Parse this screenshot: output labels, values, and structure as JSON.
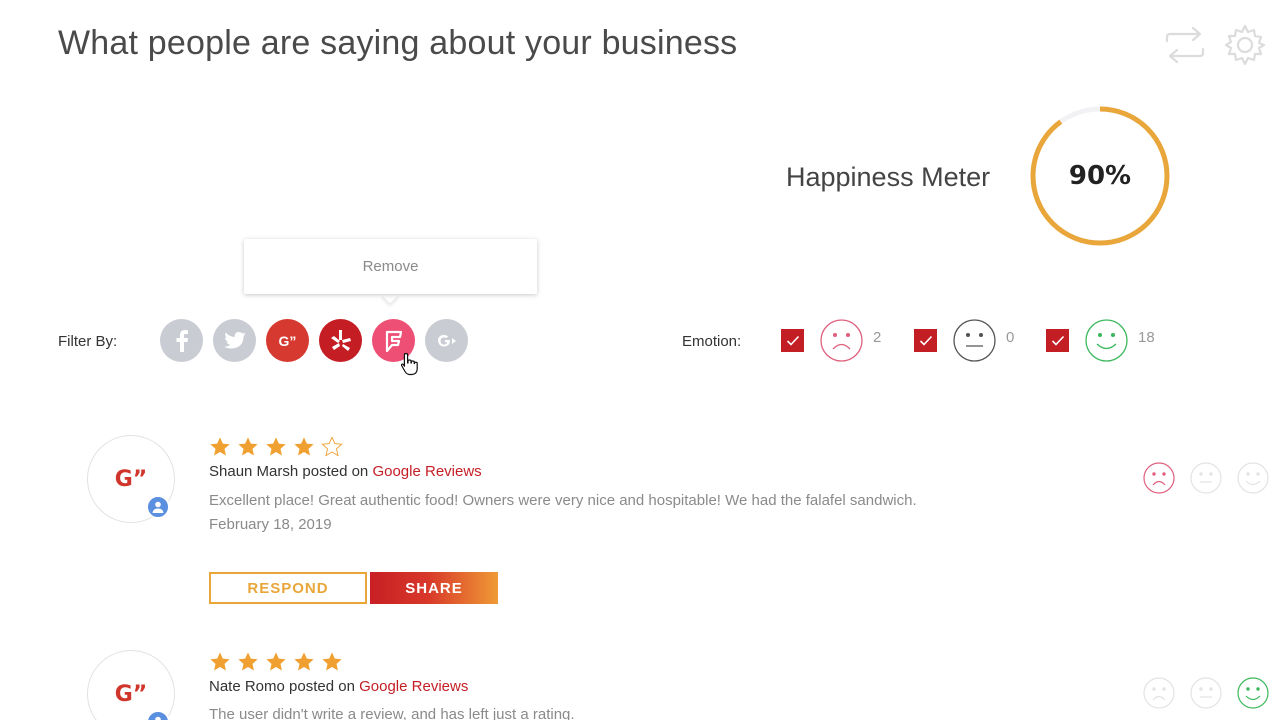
{
  "header": {
    "title": "What people are saying about your business",
    "icons": [
      "sync-icon",
      "gear-icon"
    ]
  },
  "happiness": {
    "label": "Happiness Meter",
    "value_text": "90%",
    "value": 0.9,
    "ring_color": "#e9a63a"
  },
  "tooltip": {
    "text": "Remove"
  },
  "filter": {
    "label": "Filter By:",
    "sources": [
      "facebook",
      "twitter",
      "google-plus",
      "yelp",
      "foursquare",
      "google-plus-disabled"
    ],
    "google_text": "G”"
  },
  "emotion": {
    "label": "Emotion:",
    "groups": [
      {
        "face": "sad",
        "checked": true,
        "count": "2",
        "color": "#e0607e"
      },
      {
        "face": "neutral",
        "checked": true,
        "count": "0",
        "color": "#555555"
      },
      {
        "face": "happy",
        "checked": true,
        "count": "18",
        "color": "#3cb85c"
      }
    ]
  },
  "reviews": [
    {
      "avatar_text": "G”",
      "rating": 4,
      "author": "Shaun Marsh",
      "posted_on": "posted on",
      "source": "Google Reviews",
      "text": "Excellent place! Great authentic food! Owners were very nice and hospitable! We had the falafel sandwich.",
      "date": "February 18, 2019",
      "respond_label": "RESPOND",
      "share_label": "SHARE",
      "emotion": "sad"
    },
    {
      "avatar_text": "G”",
      "rating": 5,
      "author": "Nate Romo",
      "posted_on": "posted on",
      "source": "Google Reviews",
      "text": "The user didn't write a review, and has left just a rating.",
      "emotion": "happy"
    }
  ],
  "colors": {
    "accent_red": "#c41e25",
    "star": "#f0a030",
    "orange": "#e9a63a"
  }
}
